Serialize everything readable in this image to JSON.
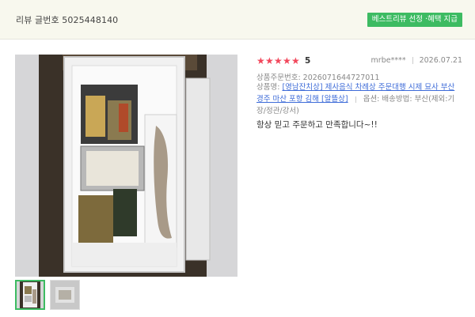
{
  "header": {
    "review_number": "리뷰 글번호 5025448140",
    "best_badge": "베스트리뷰 선정 ·혜택 지급"
  },
  "review": {
    "rating_value": 5,
    "score": "5",
    "user": "mrbe****",
    "date": "2026.07.21",
    "order_number": "상품주문번호: 2026071644727011",
    "product_prefix": "상품명:",
    "product_name": "[영남잔치상] 제사음식 차례상 주문대행 시제 묘사 부산 경주 마산 포항 김해 [알뜰상]",
    "option": "옵션: 배송방법: 부산(제외:기장/정관/강서)",
    "text": "항상 믿고 주문하고 만족합니다~!!"
  },
  "colors": {
    "accent_green": "#3dbb62",
    "star_red": "#f2485c",
    "link_blue": "#3d6bd8"
  },
  "icons": {
    "star": "star-icon"
  }
}
